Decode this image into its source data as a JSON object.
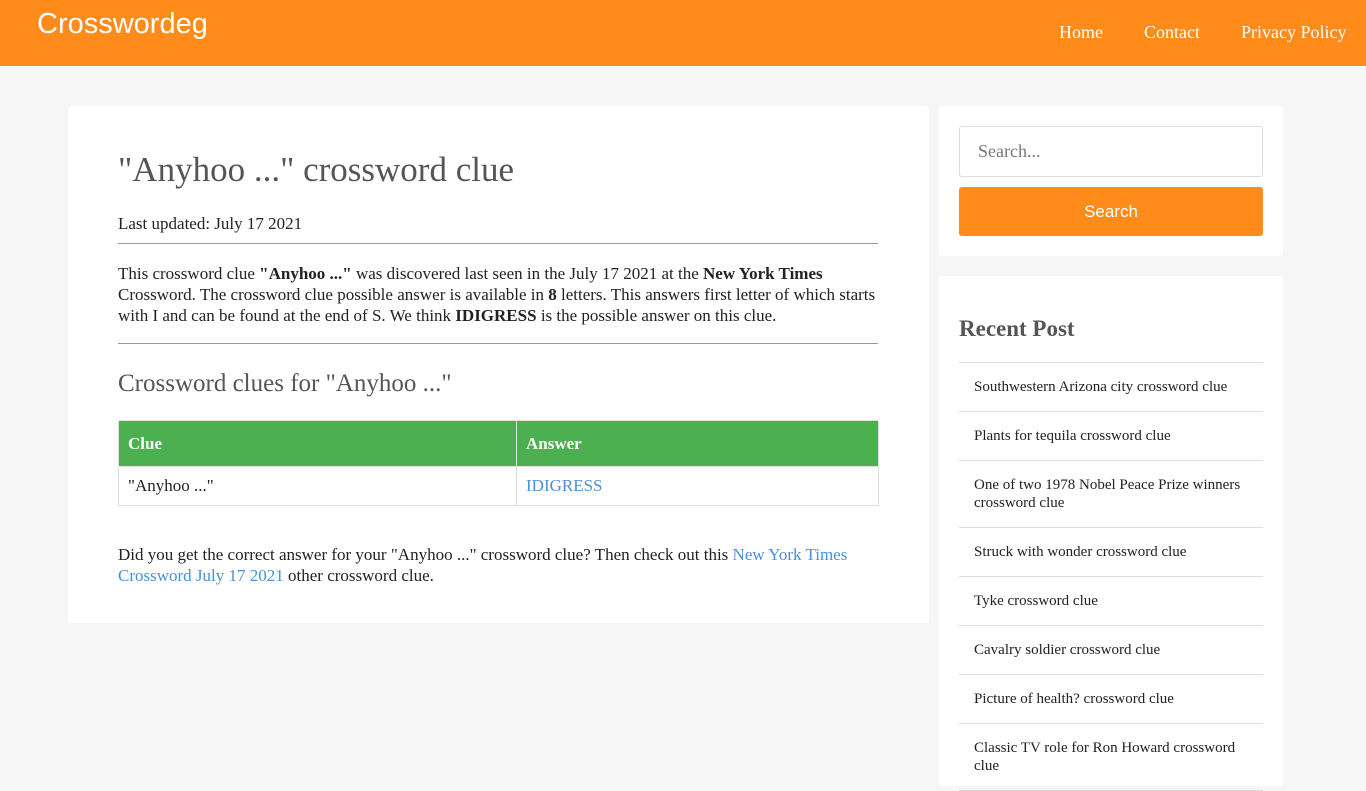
{
  "header": {
    "logo": "Crosswordeg",
    "nav": [
      {
        "label": "Home"
      },
      {
        "label": "Contact"
      },
      {
        "label": "Privacy Policy"
      }
    ]
  },
  "article": {
    "title": "\"Anyhoo ...\" crossword clue",
    "last_updated": "Last updated: July 17 2021",
    "para": {
      "t1": "This crossword clue ",
      "clue_bold": "\"Anyhoo ...\"",
      "t2": " was discovered last seen in the July 17 2021 at the ",
      "source_bold": "New York Times",
      "t3": " Crossword. The crossword clue possible answer is available in ",
      "letters_bold": "8",
      "t4": " letters. This answers first letter of which starts with I and can be found at the end of S. We think ",
      "answer_bold": "IDIGRESS",
      "t5": " is the possible answer on this clue."
    },
    "subtitle": "Crossword clues for \"Anyhoo ...\"",
    "table": {
      "headers": [
        "Clue",
        "Answer"
      ],
      "rows": [
        {
          "clue": "\"Anyhoo ...\"",
          "answer": "IDIGRESS"
        }
      ]
    },
    "outro": {
      "t1": "Did you get the correct answer for your \"Anyhoo ...\" crossword clue? Then check out this ",
      "link": "New York Times Crossword July 17 2021",
      "t2": " other crossword clue."
    }
  },
  "sidebar": {
    "search_placeholder": "Search...",
    "search_button": "Search",
    "recent_title": "Recent Post",
    "recent": [
      "Southwestern Arizona city crossword clue",
      "Plants for tequila crossword clue",
      "One of two 1978 Nobel Peace Prize winners crossword clue",
      "Struck with wonder crossword clue",
      "Tyke crossword clue",
      "Cavalry soldier crossword clue",
      "Picture of health? crossword clue",
      "Classic TV role for Ron Howard crossword clue"
    ]
  },
  "colors": {
    "brand_orange": "#ff8c1a",
    "table_header_green": "#4caf50",
    "link_blue": "#4a90d9",
    "page_bg": "#f6f6f6"
  }
}
